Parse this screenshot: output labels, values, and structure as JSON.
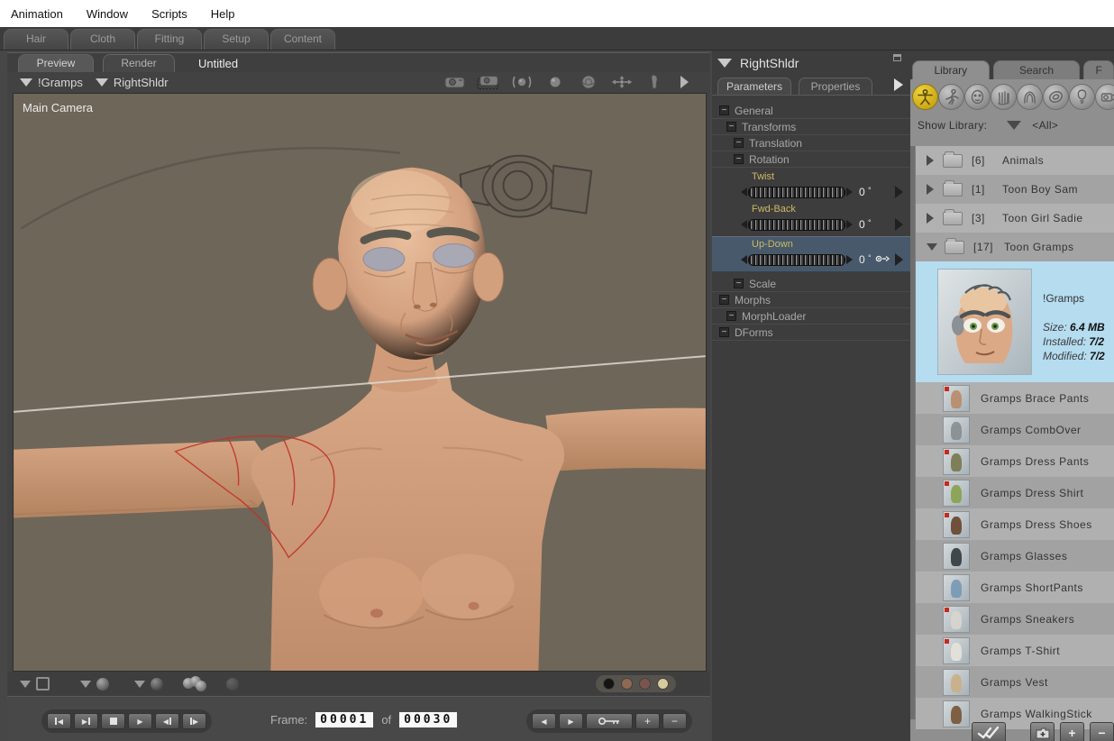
{
  "menu_bar": {
    "items": [
      "Animation",
      "Window",
      "Scripts",
      "Help"
    ]
  },
  "room_tabs": {
    "tabs": [
      "Hair",
      "Cloth",
      "Fitting",
      "Setup",
      "Content"
    ]
  },
  "document": {
    "view_tabs": [
      "Preview",
      "Render"
    ],
    "title": "Untitled",
    "figure_selector": "!Gramps",
    "actor_selector": "RightShldr",
    "camera_label": "Main Camera",
    "camera_tools": [
      "face-camera",
      "select-camera",
      "orbit-camera",
      "dolly-ball",
      "trackball",
      "move-tool",
      "flashlight-tool"
    ],
    "display_swatch_colors": [
      "#141414",
      "#8f6a52",
      "#7a5550",
      "#d6cb9b"
    ]
  },
  "timeline": {
    "frame_label": "Frame:",
    "current_frame": "00001",
    "of_label": "of",
    "total_frames": "00030"
  },
  "parameters_panel": {
    "title": "RightShldr",
    "tabs": [
      "Parameters",
      "Properties"
    ],
    "tree": [
      "General",
      "Transforms",
      "Translation",
      "Rotation"
    ],
    "dials": [
      {
        "name": "Twist",
        "value": "0",
        "unit": "°",
        "selected": false
      },
      {
        "name": "Fwd-Back",
        "value": "0",
        "unit": "°",
        "selected": false
      },
      {
        "name": "Up-Down",
        "value": "0",
        "unit": "°",
        "selected": true
      }
    ],
    "tree_after": [
      "Scale",
      "Morphs",
      "MorphLoader",
      "DForms"
    ]
  },
  "library": {
    "tabs": [
      "Library",
      "Search",
      "F"
    ],
    "categories": [
      "figures",
      "poses",
      "expressions",
      "hands",
      "hair",
      "props",
      "lights",
      "cameras"
    ],
    "show_library_label": "Show Library:",
    "show_library_value": "<All>",
    "folders": [
      {
        "count": "[6]",
        "name": "Animals",
        "expanded": false
      },
      {
        "count": "[1]",
        "name": "Toon Boy Sam",
        "expanded": false
      },
      {
        "count": "[3]",
        "name": "Toon Girl Sadie",
        "expanded": false
      },
      {
        "count": "[17]",
        "name": "Toon Gramps",
        "expanded": true
      }
    ],
    "selected_item": {
      "name": "!Gramps",
      "size_label": "Size:",
      "size_value": "6.4 MB",
      "installed_label": "Installed:",
      "installed_value": "7/2",
      "modified_label": "Modified:",
      "modified_value": "7/2"
    },
    "items": [
      {
        "label": "Gramps Brace Pants",
        "thumb_color": "#b98d6e",
        "flagged": true
      },
      {
        "label": "Gramps CombOver",
        "thumb_color": "#8a8f93",
        "flagged": false
      },
      {
        "label": "Gramps Dress Pants",
        "thumb_color": "#7a7a52",
        "flagged": true
      },
      {
        "label": "Gramps Dress Shirt",
        "thumb_color": "#8aa352",
        "flagged": true
      },
      {
        "label": "Gramps Dress Shoes",
        "thumb_color": "#6b4a33",
        "flagged": true
      },
      {
        "label": "Gramps Glasses",
        "thumb_color": "#3a3f45",
        "flagged": false
      },
      {
        "label": "Gramps ShortPants",
        "thumb_color": "#7a9ab5",
        "flagged": false
      },
      {
        "label": "Gramps Sneakers",
        "thumb_color": "#d8d4cc",
        "flagged": true
      },
      {
        "label": "Gramps T-Shirt",
        "thumb_color": "#e5e2da",
        "flagged": true
      },
      {
        "label": "Gramps Vest",
        "thumb_color": "#c8b188",
        "flagged": false
      },
      {
        "label": "Gramps WalkingStick",
        "thumb_color": "#7a5a3a",
        "flagged": false
      }
    ]
  }
}
